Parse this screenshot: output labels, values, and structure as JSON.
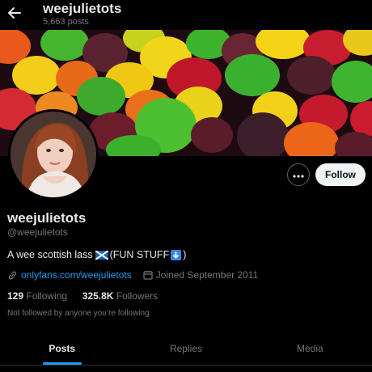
{
  "header": {
    "back_icon": "arrow-left-icon",
    "title": "weejulietots",
    "posts_count": "5,663 posts"
  },
  "banner": {
    "description_icon": "candy-banner-image"
  },
  "profile": {
    "display_name": "weejulietots",
    "handle": "@weejulietots",
    "bio_text": "A wee scottish lass",
    "bio_suffix": "(FUN STUFF",
    "bio_close": ")",
    "link": "onlyfans.com/weejulietots",
    "joined": "Joined September 2011"
  },
  "actions": {
    "more_icon": "more-options-icon",
    "follow_label": "Follow"
  },
  "stats": {
    "following_count": "129",
    "following_label": "Following",
    "followers_count": "325.8K",
    "followers_label": "Followers"
  },
  "note": "Not followed by anyone you’re following",
  "tabs": [
    {
      "label": "Posts",
      "active": true
    },
    {
      "label": "Replies",
      "active": false
    },
    {
      "label": "Media",
      "active": false
    }
  ],
  "colors": {
    "accent": "#1d9bf0",
    "text": "#e7e9ea",
    "muted": "#71767b",
    "background": "#000000"
  }
}
